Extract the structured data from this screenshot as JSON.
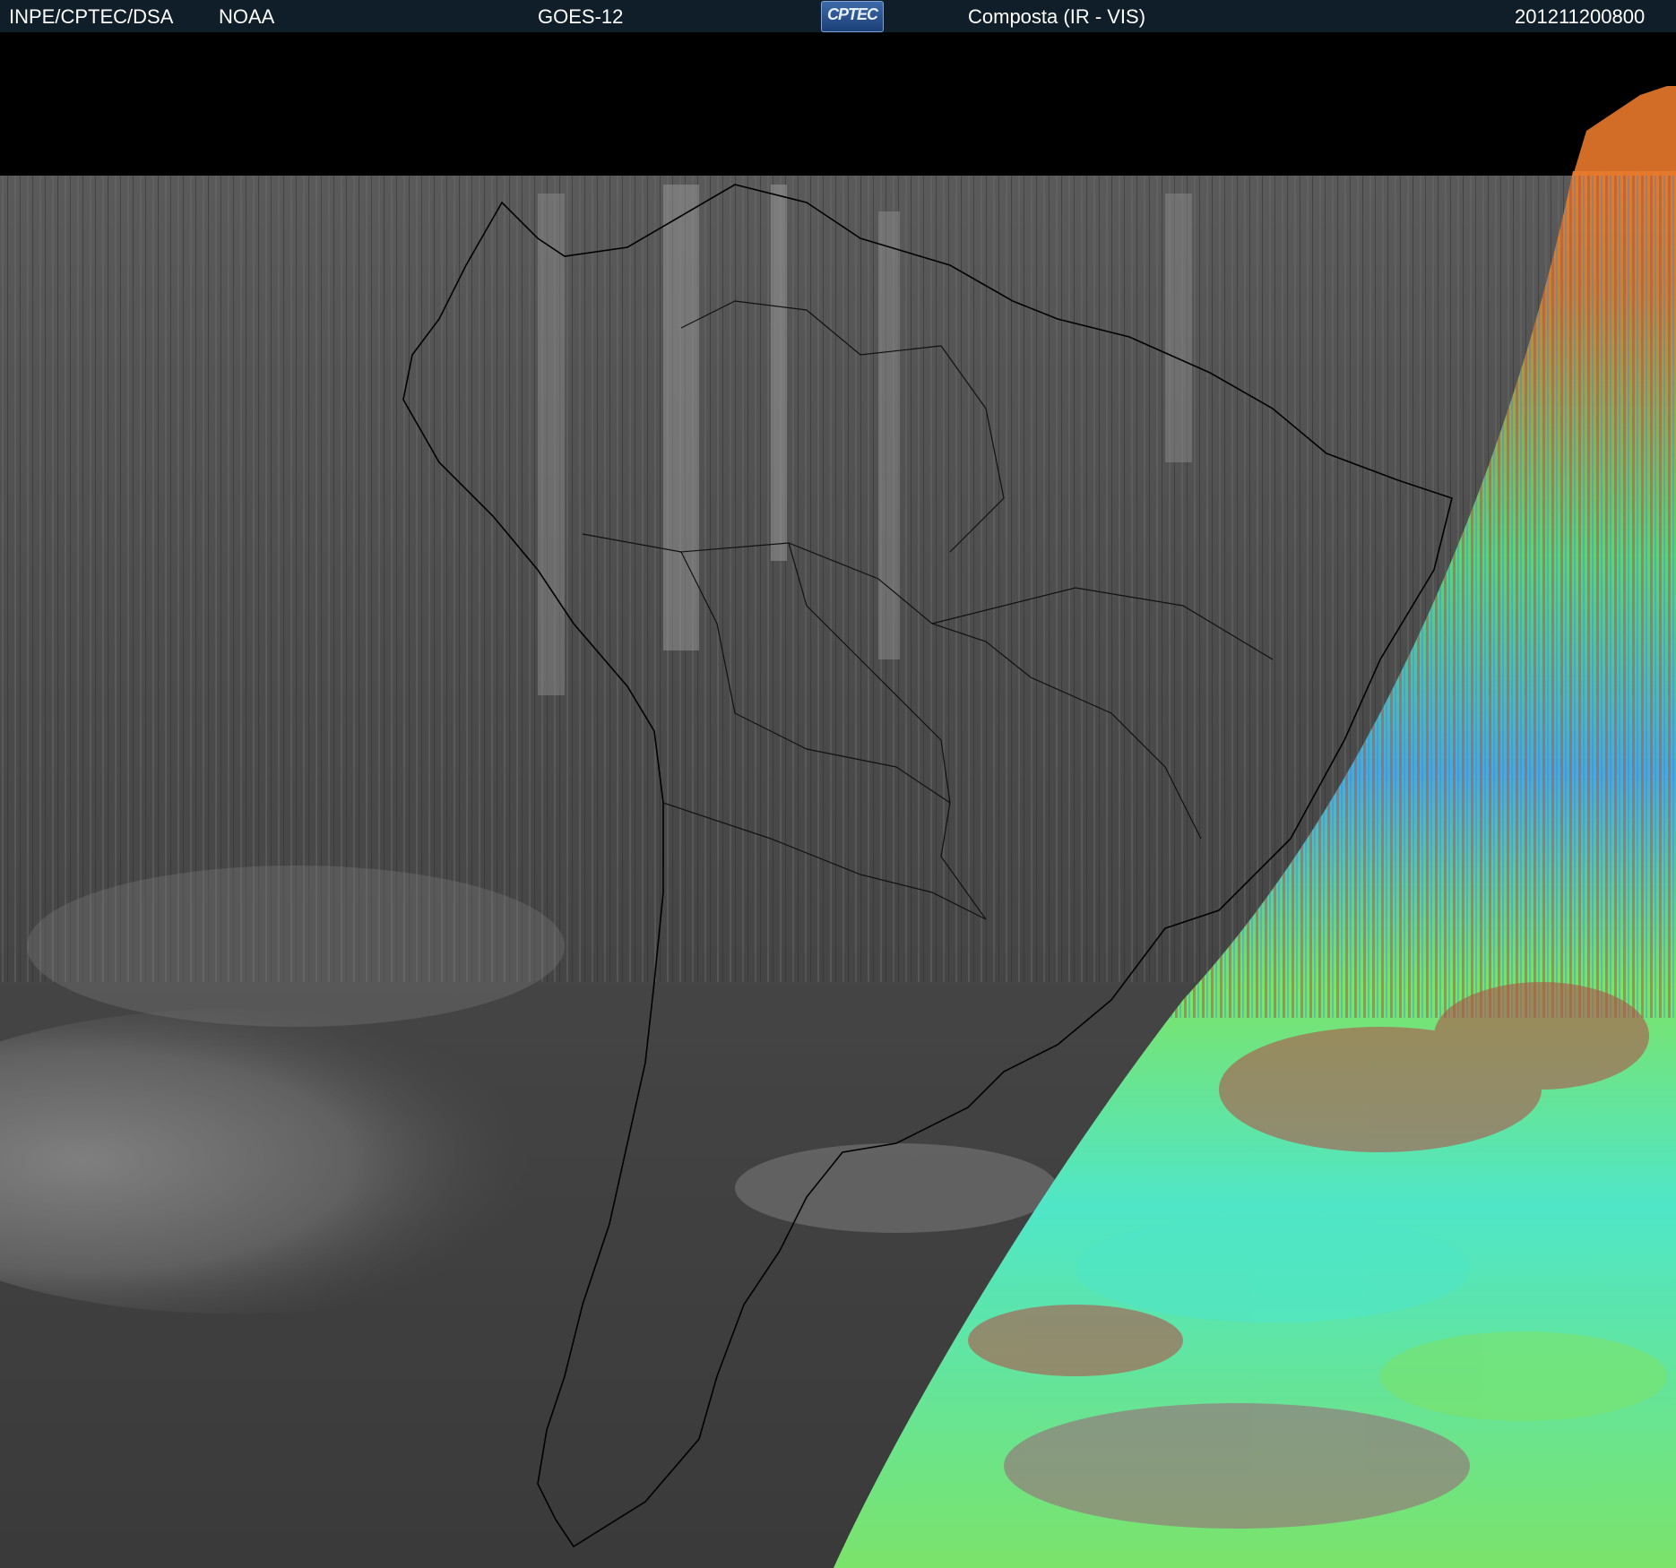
{
  "header": {
    "org": "INPE/CPTEC/DSA",
    "agency": "NOAA",
    "satellite": "GOES-12",
    "logo_text": "CPTEC",
    "product": "Composta (IR - VIS)",
    "timestamp": "201211200800"
  },
  "map": {
    "region": "South America",
    "night_side": "infrared grayscale",
    "day_side": "visible false-color",
    "colors": {
      "background": "#000000",
      "header_bg": "#101e2a",
      "ir_gray": "#4a4a4a",
      "vis_green": "#7be36a",
      "vis_cyan": "#4fe6c8",
      "vis_red": "#b0524a",
      "vis_orange": "#e8792b",
      "coastline": "#000000"
    }
  }
}
